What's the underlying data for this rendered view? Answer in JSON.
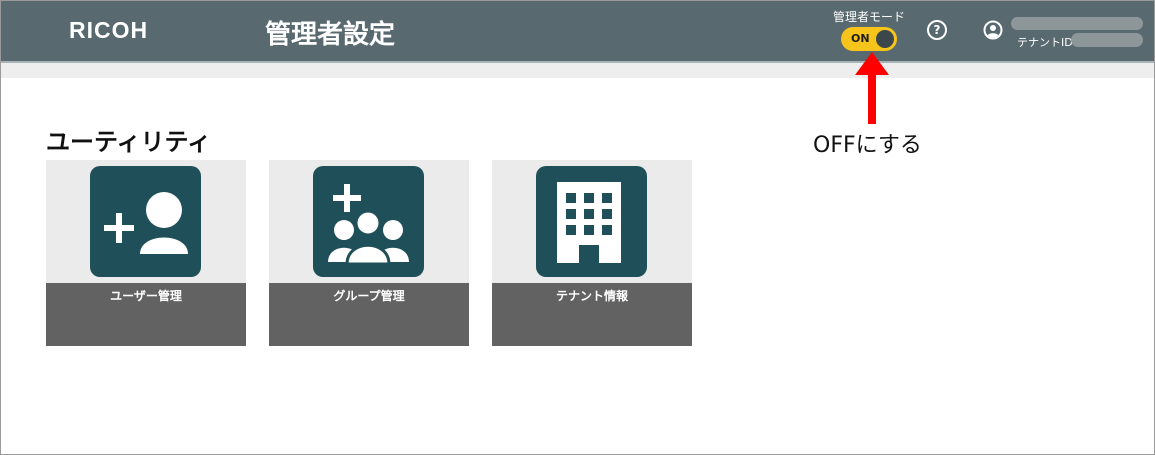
{
  "header": {
    "logo": "RICOH",
    "title": "管理者設定",
    "admin_mode": {
      "label": "管理者モード",
      "toggle_text": "ON",
      "is_on": true
    },
    "help_symbol": "?",
    "user": {
      "tenant_label": "テナントID :"
    }
  },
  "colors": {
    "header_bg": "#58696f",
    "toggle_accent": "#f6c41a",
    "tile_icon_bg": "#1f4f58",
    "tile_label_bg": "#626262",
    "annotation": "#ff0000"
  },
  "main": {
    "section_title": "ユーティリティ",
    "tiles": [
      {
        "label": "ユーザー管理",
        "icon": "add-user-icon"
      },
      {
        "label": "グループ管理",
        "icon": "add-group-icon"
      },
      {
        "label": "テナント情報",
        "icon": "building-icon"
      }
    ]
  },
  "annotation": {
    "text": "OFFにする",
    "icon": "red-arrow-up-icon"
  }
}
